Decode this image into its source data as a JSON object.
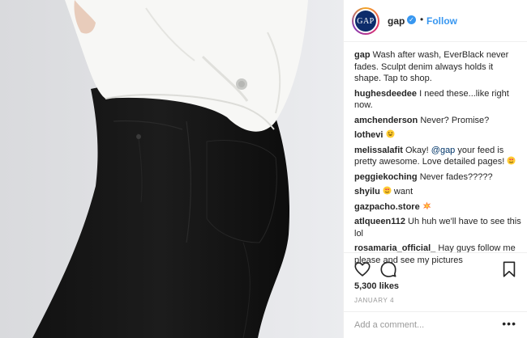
{
  "post": {
    "image_alt": "woman in black jeans and white denim jacket",
    "account": {
      "handle": "gap",
      "logo_text": "GAP",
      "verified_icon": "verified-check-icon",
      "follow_label": "Follow",
      "separator": "•"
    },
    "comments": [
      {
        "user": "gap",
        "text": "Wash after wash, EverBlack never fades. Sculpt denim always holds it shape. Tap to shop."
      },
      {
        "user": "hughesdeedee",
        "text": "I need these...like right now."
      },
      {
        "user": "amchenderson",
        "text": "Never? Promise?"
      },
      {
        "user": "lothevi",
        "text": "",
        "emoji": "grinning-face"
      },
      {
        "user": "melissalafit",
        "pre": "Okay! ",
        "mention": "@gap",
        "text": " your feed is pretty awesome. Love detailed pages! ",
        "emoji": "heart-eyes-face"
      },
      {
        "user": "peggiekoching",
        "text": "Never fades?????"
      },
      {
        "user": "shyilu",
        "text": " want",
        "emoji_before": "heart-eyes-face"
      },
      {
        "user": "gazpacho.store",
        "text": "",
        "emoji": "collision"
      },
      {
        "user": "atlqueen112",
        "text": "Uh huh we'll have to see this lol"
      },
      {
        "user": "rosamaria_official_",
        "text": "Hay guys follow me please and see my pictures"
      }
    ],
    "likes_label": "5,300 likes",
    "date": "JANUARY 4",
    "add_comment_placeholder": "Add a comment...",
    "more_label": "•••",
    "icons": {
      "like": "heart-outline-icon",
      "comment": "speech-bubble-icon",
      "save": "bookmark-icon"
    },
    "colors": {
      "link_blue": "#3897f0",
      "mention_blue": "#003569",
      "text": "#262626",
      "muted": "#999999",
      "gap_navy": "#0d2c6b"
    }
  }
}
